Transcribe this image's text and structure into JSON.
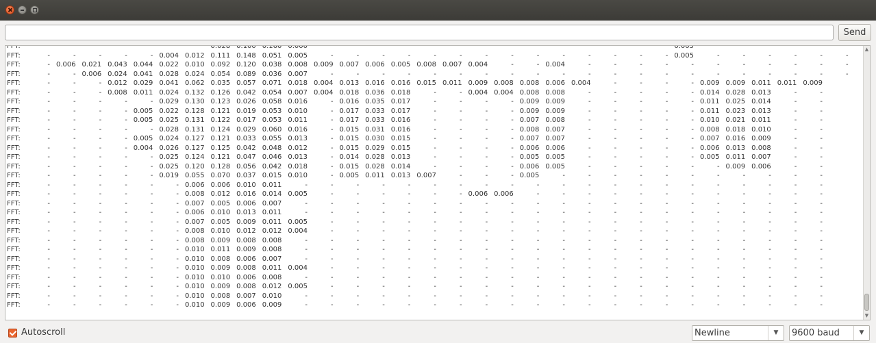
{
  "toolbar": {
    "send_label": "Send",
    "input_value": ""
  },
  "output": {
    "prefix": "FFT:",
    "partial_top": [
      "",
      "",
      "",
      "",
      "",
      "",
      "",
      "0.028",
      "0.100",
      "0.160",
      "0.000",
      "",
      "",
      "",
      "",
      "",
      "",
      "",
      "",
      "",
      "",
      "",
      "",
      "",
      "",
      "0.005",
      "",
      "",
      "",
      "",
      "",
      ""
    ],
    "rows": [
      [
        "-",
        "-",
        "-",
        "-",
        "-",
        "0.004",
        "0.012",
        "0.111",
        "0.148",
        "0.051",
        "0.005",
        "-",
        "-",
        "-",
        "-",
        "-",
        "-",
        "-",
        "-",
        "-",
        "-",
        "-",
        "-",
        "-",
        "-",
        "0.005",
        "-",
        "-",
        "-",
        "-",
        "-",
        "-"
      ],
      [
        "-",
        "0.006",
        "0.021",
        "0.043",
        "0.044",
        "0.022",
        "0.010",
        "0.092",
        "0.120",
        "0.038",
        "0.008",
        "0.009",
        "0.007",
        "0.006",
        "0.005",
        "0.008",
        "0.007",
        "0.004",
        "-",
        "-",
        "0.004",
        "-",
        "-",
        "-",
        "-",
        "-",
        "-",
        "-",
        "-",
        "-",
        "-",
        "-"
      ],
      [
        "-",
        "-",
        "0.006",
        "0.024",
        "0.041",
        "0.028",
        "0.024",
        "0.054",
        "0.089",
        "0.036",
        "0.007",
        "-",
        "-",
        "-",
        "-",
        "-",
        "-",
        "-",
        "-",
        "-",
        "-",
        "-",
        "-",
        "-",
        "-",
        "-",
        "-",
        "-",
        "-",
        "-",
        "-",
        "-"
      ],
      [
        "-",
        "-",
        "-",
        "0.012",
        "0.029",
        "0.041",
        "0.062",
        "0.035",
        "0.057",
        "0.071",
        "0.018",
        "0.004",
        "0.013",
        "0.016",
        "0.016",
        "0.015",
        "0.011",
        "0.009",
        "0.008",
        "0.008",
        "0.006",
        "0.004",
        "-",
        "-",
        "-",
        "-",
        "0.009",
        "0.009",
        "0.011",
        "0.011",
        "0.009",
        ""
      ],
      [
        "-",
        "-",
        "-",
        "0.008",
        "0.011",
        "0.024",
        "0.132",
        "0.126",
        "0.042",
        "0.054",
        "0.007",
        "0.004",
        "0.018",
        "0.036",
        "0.018",
        "-",
        "-",
        "0.004",
        "0.004",
        "0.008",
        "0.008",
        "-",
        "-",
        "-",
        "-",
        "-",
        "0.014",
        "0.028",
        "0.013",
        "-",
        "-",
        ""
      ],
      [
        "-",
        "-",
        "-",
        "-",
        "-",
        "0.029",
        "0.130",
        "0.123",
        "0.026",
        "0.058",
        "0.016",
        "-",
        "0.016",
        "0.035",
        "0.017",
        "-",
        "-",
        "-",
        "-",
        "0.009",
        "0.009",
        "-",
        "-",
        "-",
        "-",
        "-",
        "0.011",
        "0.025",
        "0.014",
        "-",
        "-",
        ""
      ],
      [
        "-",
        "-",
        "-",
        "-",
        "0.005",
        "0.022",
        "0.128",
        "0.121",
        "0.019",
        "0.053",
        "0.010",
        "-",
        "0.017",
        "0.033",
        "0.017",
        "-",
        "-",
        "-",
        "-",
        "0.009",
        "0.009",
        "-",
        "-",
        "-",
        "-",
        "-",
        "0.011",
        "0.023",
        "0.013",
        "-",
        "-",
        ""
      ],
      [
        "-",
        "-",
        "-",
        "-",
        "0.005",
        "0.025",
        "0.131",
        "0.122",
        "0.017",
        "0.053",
        "0.011",
        "-",
        "0.017",
        "0.033",
        "0.016",
        "-",
        "-",
        "-",
        "-",
        "0.007",
        "0.008",
        "-",
        "-",
        "-",
        "-",
        "-",
        "0.010",
        "0.021",
        "0.011",
        "-",
        "-",
        ""
      ],
      [
        "-",
        "-",
        "-",
        "-",
        "-",
        "0.028",
        "0.131",
        "0.124",
        "0.029",
        "0.060",
        "0.016",
        "-",
        "0.015",
        "0.031",
        "0.016",
        "-",
        "-",
        "-",
        "-",
        "0.008",
        "0.007",
        "-",
        "-",
        "-",
        "-",
        "-",
        "0.008",
        "0.018",
        "0.010",
        "-",
        "-",
        ""
      ],
      [
        "-",
        "-",
        "-",
        "-",
        "0.005",
        "0.024",
        "0.127",
        "0.121",
        "0.033",
        "0.055",
        "0.013",
        "-",
        "0.015",
        "0.030",
        "0.015",
        "-",
        "-",
        "-",
        "-",
        "0.007",
        "0.007",
        "-",
        "-",
        "-",
        "-",
        "-",
        "0.007",
        "0.016",
        "0.009",
        "-",
        "-",
        ""
      ],
      [
        "-",
        "-",
        "-",
        "-",
        "0.004",
        "0.026",
        "0.127",
        "0.125",
        "0.042",
        "0.048",
        "0.012",
        "-",
        "0.015",
        "0.029",
        "0.015",
        "-",
        "-",
        "-",
        "-",
        "0.006",
        "0.006",
        "-",
        "-",
        "-",
        "-",
        "-",
        "0.006",
        "0.013",
        "0.008",
        "-",
        "-",
        ""
      ],
      [
        "-",
        "-",
        "-",
        "-",
        "-",
        "0.025",
        "0.124",
        "0.121",
        "0.047",
        "0.046",
        "0.013",
        "-",
        "0.014",
        "0.028",
        "0.013",
        "-",
        "-",
        "-",
        "-",
        "0.005",
        "0.005",
        "-",
        "-",
        "-",
        "-",
        "-",
        "0.005",
        "0.011",
        "0.007",
        "-",
        "-",
        ""
      ],
      [
        "-",
        "-",
        "-",
        "-",
        "-",
        "0.025",
        "0.120",
        "0.128",
        "0.056",
        "0.042",
        "0.018",
        "-",
        "0.015",
        "0.028",
        "0.014",
        "-",
        "-",
        "-",
        "-",
        "0.006",
        "0.005",
        "-",
        "-",
        "-",
        "-",
        "-",
        "-",
        "0.009",
        "0.006",
        "-",
        "-",
        ""
      ],
      [
        "-",
        "-",
        "-",
        "-",
        "-",
        "0.019",
        "0.055",
        "0.070",
        "0.037",
        "0.015",
        "0.010",
        "-",
        "0.005",
        "0.011",
        "0.013",
        "0.007",
        "-",
        "-",
        "-",
        "0.005",
        "-",
        "-",
        "-",
        "-",
        "-",
        "-",
        "-",
        "-",
        "-",
        "-",
        "-",
        ""
      ],
      [
        "-",
        "-",
        "-",
        "-",
        "-",
        "-",
        "0.006",
        "0.006",
        "0.010",
        "0.011",
        "-",
        "-",
        "-",
        "-",
        "-",
        "-",
        "-",
        "-",
        "-",
        "-",
        "-",
        "-",
        "-",
        "-",
        "-",
        "-",
        "-",
        "-",
        "-",
        "-",
        "-",
        ""
      ],
      [
        "-",
        "-",
        "-",
        "-",
        "-",
        "-",
        "0.008",
        "0.012",
        "0.016",
        "0.014",
        "0.005",
        "-",
        "-",
        "-",
        "-",
        "-",
        "-",
        "0.006",
        "0.006",
        "-",
        "-",
        "-",
        "-",
        "-",
        "-",
        "-",
        "-",
        "-",
        "-",
        "-",
        "-",
        ""
      ],
      [
        "-",
        "-",
        "-",
        "-",
        "-",
        "-",
        "0.007",
        "0.005",
        "0.006",
        "0.007",
        "-",
        "-",
        "-",
        "-",
        "-",
        "-",
        "-",
        "-",
        "-",
        "-",
        "-",
        "-",
        "-",
        "-",
        "-",
        "-",
        "-",
        "-",
        "-",
        "-",
        "-",
        ""
      ],
      [
        "-",
        "-",
        "-",
        "-",
        "-",
        "-",
        "0.006",
        "0.010",
        "0.013",
        "0.011",
        "-",
        "-",
        "-",
        "-",
        "-",
        "-",
        "-",
        "-",
        "-",
        "-",
        "-",
        "-",
        "-",
        "-",
        "-",
        "-",
        "-",
        "-",
        "-",
        "-",
        "-",
        ""
      ],
      [
        "-",
        "-",
        "-",
        "-",
        "-",
        "-",
        "0.007",
        "0.005",
        "0.009",
        "0.011",
        "0.005",
        "-",
        "-",
        "-",
        "-",
        "-",
        "-",
        "-",
        "-",
        "-",
        "-",
        "-",
        "-",
        "-",
        "-",
        "-",
        "-",
        "-",
        "-",
        "-",
        "-",
        ""
      ],
      [
        "-",
        "-",
        "-",
        "-",
        "-",
        "-",
        "0.008",
        "0.010",
        "0.012",
        "0.012",
        "0.004",
        "-",
        "-",
        "-",
        "-",
        "-",
        "-",
        "-",
        "-",
        "-",
        "-",
        "-",
        "-",
        "-",
        "-",
        "-",
        "-",
        "-",
        "-",
        "-",
        "-",
        ""
      ],
      [
        "-",
        "-",
        "-",
        "-",
        "-",
        "-",
        "0.008",
        "0.009",
        "0.008",
        "0.008",
        "-",
        "-",
        "-",
        "-",
        "-",
        "-",
        "-",
        "-",
        "-",
        "-",
        "-",
        "-",
        "-",
        "-",
        "-",
        "-",
        "-",
        "-",
        "-",
        "-",
        "-",
        ""
      ],
      [
        "-",
        "-",
        "-",
        "-",
        "-",
        "-",
        "0.010",
        "0.011",
        "0.009",
        "0.008",
        "-",
        "-",
        "-",
        "-",
        "-",
        "-",
        "-",
        "-",
        "-",
        "-",
        "-",
        "-",
        "-",
        "-",
        "-",
        "-",
        "-",
        "-",
        "-",
        "-",
        "-",
        ""
      ],
      [
        "-",
        "-",
        "-",
        "-",
        "-",
        "-",
        "0.010",
        "0.008",
        "0.006",
        "0.007",
        "-",
        "-",
        "-",
        "-",
        "-",
        "-",
        "-",
        "-",
        "-",
        "-",
        "-",
        "-",
        "-",
        "-",
        "-",
        "-",
        "-",
        "-",
        "-",
        "-",
        "-",
        ""
      ],
      [
        "-",
        "-",
        "-",
        "-",
        "-",
        "-",
        "0.010",
        "0.009",
        "0.008",
        "0.011",
        "0.004",
        "-",
        "-",
        "-",
        "-",
        "-",
        "-",
        "-",
        "-",
        "-",
        "-",
        "-",
        "-",
        "-",
        "-",
        "-",
        "-",
        "-",
        "-",
        "-",
        "-",
        ""
      ],
      [
        "-",
        "-",
        "-",
        "-",
        "-",
        "-",
        "0.010",
        "0.010",
        "0.006",
        "0.008",
        "-",
        "-",
        "-",
        "-",
        "-",
        "-",
        "-",
        "-",
        "-",
        "-",
        "-",
        "-",
        "-",
        "-",
        "-",
        "-",
        "-",
        "-",
        "-",
        "-",
        "-",
        ""
      ],
      [
        "-",
        "-",
        "-",
        "-",
        "-",
        "-",
        "0.010",
        "0.009",
        "0.008",
        "0.012",
        "0.005",
        "-",
        "-",
        "-",
        "-",
        "-",
        "-",
        "-",
        "-",
        "-",
        "-",
        "-",
        "-",
        "-",
        "-",
        "-",
        "-",
        "-",
        "-",
        "-",
        "-",
        ""
      ],
      [
        "-",
        "-",
        "-",
        "-",
        "-",
        "-",
        "0.010",
        "0.008",
        "0.007",
        "0.010",
        "-",
        "-",
        "-",
        "-",
        "-",
        "-",
        "-",
        "-",
        "-",
        "-",
        "-",
        "-",
        "-",
        "-",
        "-",
        "-",
        "-",
        "-",
        "-",
        "-",
        "-",
        ""
      ],
      [
        "-",
        "-",
        "-",
        "-",
        "-",
        "-",
        "0.010",
        "0.009",
        "0.006",
        "0.009",
        "-",
        "-",
        "-",
        "-",
        "-",
        "-",
        "-",
        "-",
        "-",
        "-",
        "-",
        "-",
        "-",
        "-",
        "-",
        "-",
        "-",
        "-",
        "-",
        "-",
        "-",
        ""
      ]
    ]
  },
  "status": {
    "autoscroll_label": "Autoscroll",
    "autoscroll_checked": true,
    "line_ending": "Newline",
    "baud": "9600 baud"
  },
  "colors": {
    "accent": "#e9642e",
    "titlebar": "#3c3b37"
  },
  "icons": {
    "close": "close-icon",
    "minimize": "minimize-icon",
    "maximize": "maximize-icon",
    "check": "check-icon",
    "dropdown": "chevron-down-icon"
  }
}
